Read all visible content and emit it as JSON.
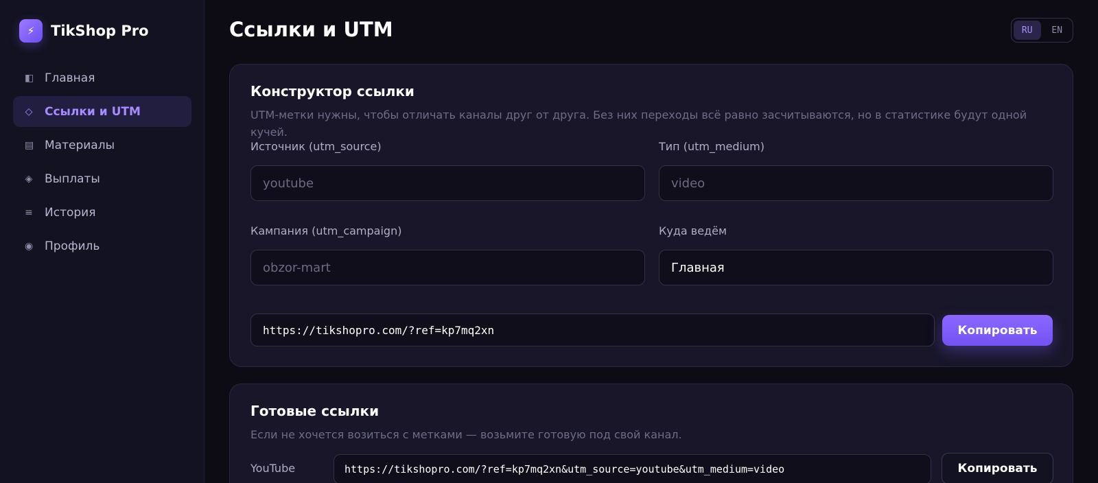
{
  "brand": {
    "name": "TikShop Pro",
    "logo_icon": "bolt-icon"
  },
  "sidebar": {
    "items": [
      {
        "label": "Главная",
        "icon": "dashboard-icon",
        "glyph": "◧",
        "active": false
      },
      {
        "label": "Ссылки и UTM",
        "icon": "link-icon",
        "glyph": "◇",
        "active": true
      },
      {
        "label": "Материалы",
        "icon": "materials-icon",
        "glyph": "▤",
        "active": false
      },
      {
        "label": "Выплаты",
        "icon": "payouts-icon",
        "glyph": "◈",
        "active": false
      },
      {
        "label": "История",
        "icon": "history-icon",
        "glyph": "≡",
        "active": false
      },
      {
        "label": "Профиль",
        "icon": "profile-icon",
        "glyph": "◉",
        "active": false
      }
    ]
  },
  "header": {
    "title": "Ссылки и UTM",
    "lang": {
      "options": [
        "RU",
        "EN"
      ],
      "selected": "RU"
    }
  },
  "builder": {
    "title": "Конструктор ссылки",
    "description": "UTM-метки нужны, чтобы отличать каналы друг от друга. Без них переходы всё равно засчитываются, но в статистике будут одной кучей.",
    "source": {
      "label": "Источник (utm_source)",
      "placeholder": "youtube",
      "value": ""
    },
    "medium": {
      "label": "Тип (utm_medium)",
      "placeholder": "video",
      "value": ""
    },
    "campaign": {
      "label": "Кампания (utm_campaign)",
      "placeholder": "obzor-mart",
      "value": ""
    },
    "target": {
      "label": "Куда ведём",
      "value": "Главная"
    },
    "result_url": "https://tikshopro.com/?ref=kp7mq2xn",
    "copy_label": "Копировать"
  },
  "ready": {
    "title": "Готовые ссылки",
    "description": "Если не хочется возиться с метками — возьмите готовую под свой канал.",
    "links": [
      {
        "channel": "YouTube",
        "url": "https://tikshopro.com/?ref=kp7mq2xn&utm_source=youtube&utm_medium=video",
        "copy_label": "Копировать"
      }
    ]
  },
  "colors": {
    "accent": "#7c5cff",
    "background": "#0d0c15",
    "card": "#181628"
  }
}
